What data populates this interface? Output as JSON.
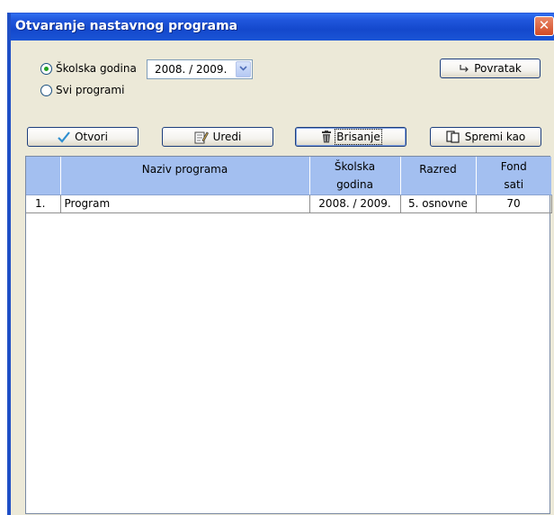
{
  "window": {
    "title": "Otvaranje nastavnog programa",
    "close_glyph": "✕"
  },
  "filter": {
    "school_year_label": "Školska godina",
    "school_year_selected": true,
    "school_year_value": "2008. / 2009.",
    "all_programs_label": "Svi programi",
    "all_programs_selected": false
  },
  "toolbar": {
    "back_label": "Povratak",
    "open_label": "Otvori",
    "edit_label": "Uredi",
    "delete_label": "Brisanje",
    "save_as_label": "Spremi kao"
  },
  "table": {
    "columns": [
      "",
      "Naziv programa",
      "Školska godina",
      "Razred",
      "Fond sati"
    ],
    "column_lines": [
      [
        "Naziv programa"
      ],
      [
        "Školska",
        "godina"
      ],
      [
        "Razred"
      ],
      [
        "Fond",
        "sati"
      ]
    ],
    "rows": [
      {
        "index": "1.",
        "name": "Program",
        "year": "2008. / 2009.",
        "grade": "5. osnovne",
        "hours": "70"
      }
    ]
  },
  "icons": {
    "open": "check-icon",
    "edit": "edit-notepad-icon",
    "delete": "trash-icon",
    "save_as": "copy-windows-icon",
    "back": "return-arrow-icon",
    "close": "close-icon"
  },
  "colors": {
    "titlebar": "#1f56dc",
    "window_bg": "#ece9d8",
    "header_bg": "#a3bff0",
    "close": "#d24a25"
  }
}
